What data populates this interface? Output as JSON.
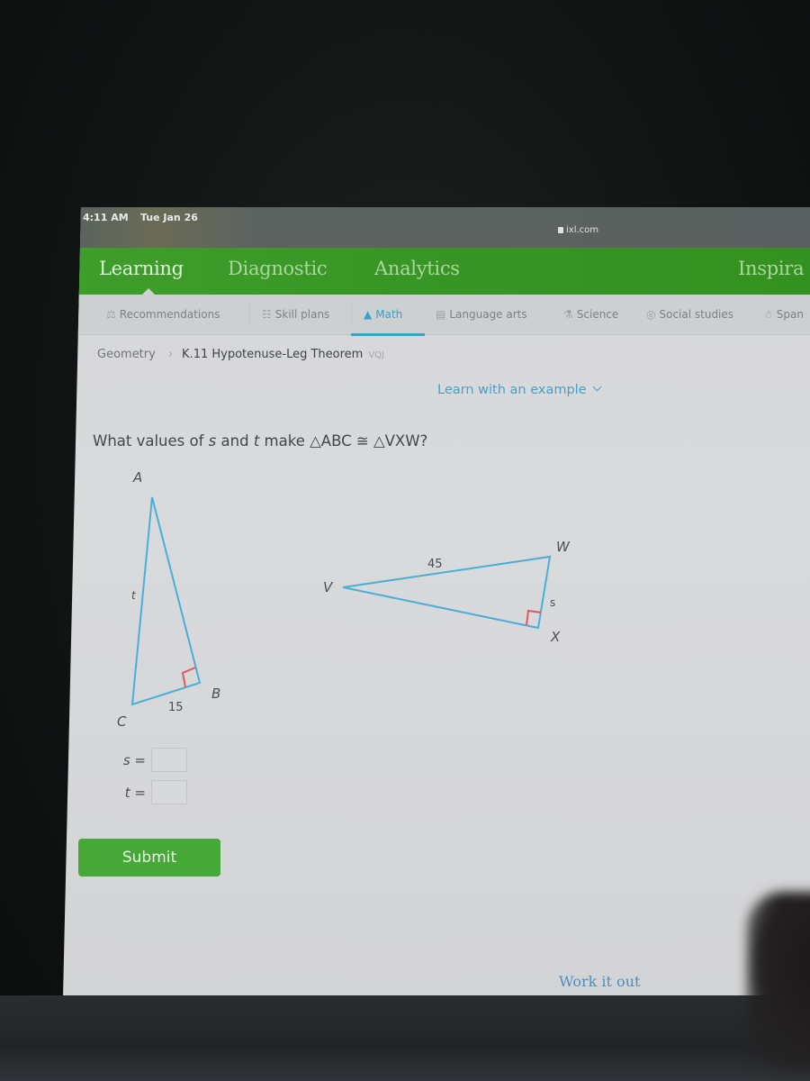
{
  "status_bar": {
    "time": "4:11 AM",
    "date": "Tue Jan 26",
    "url": "ixl.com"
  },
  "top_nav": {
    "items": [
      {
        "label": "Learning",
        "active": true
      },
      {
        "label": "Diagnostic",
        "active": false
      },
      {
        "label": "Analytics",
        "active": false
      },
      {
        "label": "Inspira",
        "active": false
      }
    ]
  },
  "sub_nav": {
    "items": [
      {
        "label": "Recommendations",
        "icon": "signpost-icon",
        "active": false
      },
      {
        "label": "Skill plans",
        "icon": "clipboard-icon",
        "active": false
      },
      {
        "label": "Math",
        "icon": "pyramid-icon",
        "active": true
      },
      {
        "label": "Language arts",
        "icon": "book-icon",
        "active": false
      },
      {
        "label": "Science",
        "icon": "flask-icon",
        "active": false
      },
      {
        "label": "Social studies",
        "icon": "globe-icon",
        "active": false
      },
      {
        "label": "Span",
        "icon": "speech-bubbles-icon",
        "active": false
      }
    ],
    "accent_color": "#3aa0cc"
  },
  "breadcrumb": {
    "parent": "Geometry",
    "current": "K.11 Hypotenuse-Leg Theorem",
    "code": "VQJ"
  },
  "learn_link": "Learn with an example",
  "question": {
    "prefix": "What values of ",
    "var_s": "s",
    "mid": " and ",
    "var_t": "t",
    "suffix": " make △ABC ≅ △VXW?"
  },
  "figure": {
    "triangle_abc": {
      "vertices": {
        "A": "A",
        "B": "B",
        "C": "C"
      },
      "side_labels": {
        "AC": "t",
        "CB": "15"
      },
      "right_angle_at": "B"
    },
    "triangle_vxw": {
      "vertices": {
        "V": "V",
        "X": "X",
        "W": "W"
      },
      "side_labels": {
        "VW": "45",
        "XW": "s"
      },
      "right_angle_at": "X"
    },
    "line_color": "#4aaed8",
    "right_angle_color": "#e0585a"
  },
  "answers": [
    {
      "var": "s",
      "equals": "=",
      "value": ""
    },
    {
      "var": "t",
      "equals": "=",
      "value": ""
    }
  ],
  "submit_label": "Submit",
  "work_it_out": "Work it out",
  "colors": {
    "brand_green": "#3f9e2b",
    "submit_green": "#45a837",
    "link_blue": "#4a9fc9"
  }
}
